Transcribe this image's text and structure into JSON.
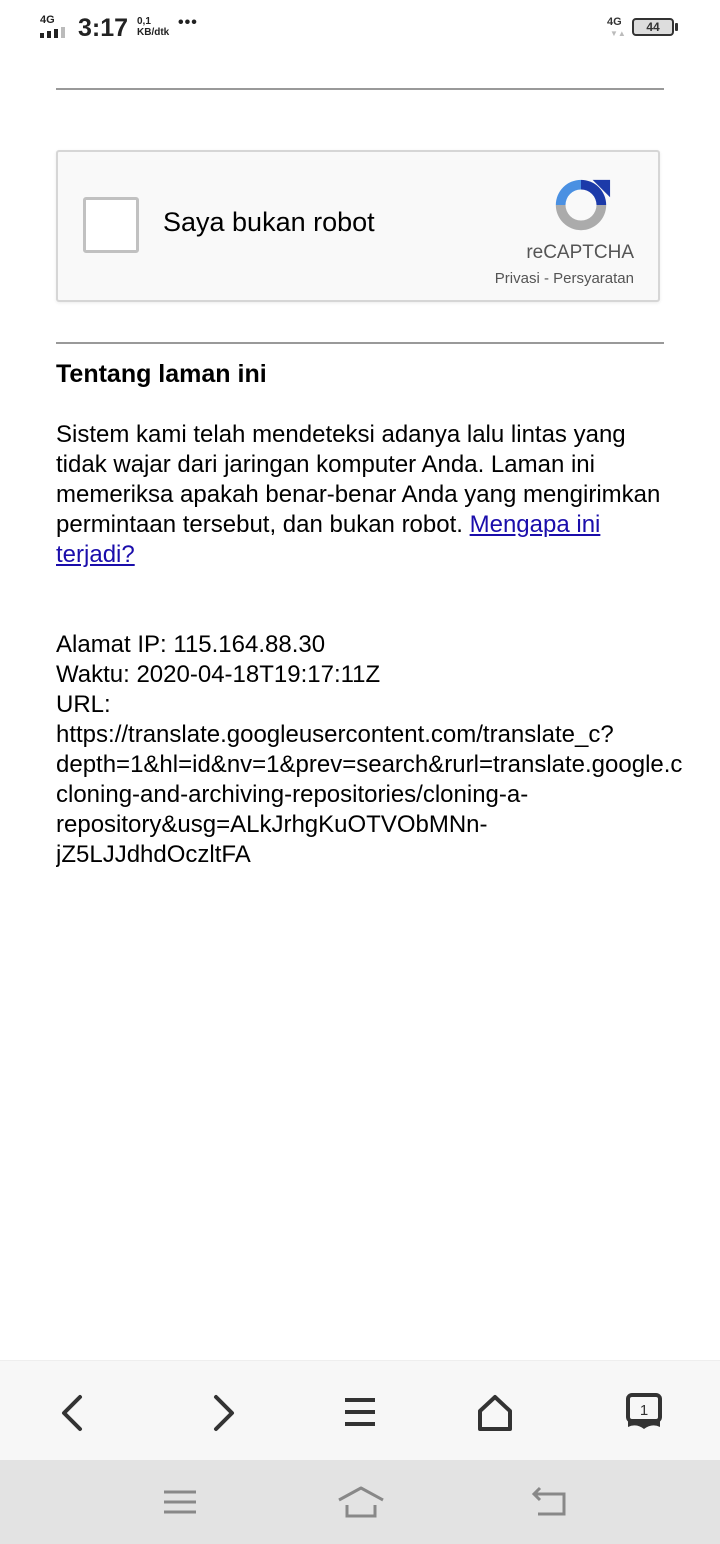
{
  "status_bar": {
    "network": "4G",
    "time": "3:17",
    "speed_value": "0,1",
    "speed_unit": "KB/dtk",
    "more": "•••",
    "network_right": "4G",
    "battery": "44"
  },
  "captcha": {
    "checkbox_label": "Saya bukan robot",
    "brand": "reCAPTCHA",
    "links": "Privasi - Persyaratan",
    "logo_icon": "recaptcha-logo-icon"
  },
  "about": {
    "heading": "Tentang laman ini",
    "paragraph": "Sistem kami telah mendeteksi adanya lalu lintas yang tidak wajar dari jaringan komputer Anda. Laman ini memeriksa apakah benar-benar Anda yang mengirimkan permintaan tersebut, dan bukan robot.",
    "link": "Mengapa ini terjadi?"
  },
  "info": {
    "ip_line": "Alamat IP: 115.164.88.30",
    "time_line": "Waktu: 2020-04-18T19:17:11Z",
    "url_label": "URL:",
    "url_lines": [
      "https://translate.googleusercontent.com/translate_c?",
      "depth=1&hl=id&nv=1&prev=search&rurl=translate.google.c",
      "cloning-and-archiving-repositories/cloning-a-",
      "repository&usg=ALkJrhgKuOTVObMNn-",
      "jZ5LJJdhdOczltFA"
    ]
  },
  "browser_nav": {
    "back_icon": "chevron-left-icon",
    "forward_icon": "chevron-right-icon",
    "menu_icon": "hamburger-icon",
    "home_icon": "home-icon",
    "tabs_icon": "tabs-icon",
    "tabs_count": "1"
  },
  "system_nav": {
    "menu_icon": "menu-icon",
    "home_icon": "home-icon",
    "back_icon": "back-icon"
  }
}
